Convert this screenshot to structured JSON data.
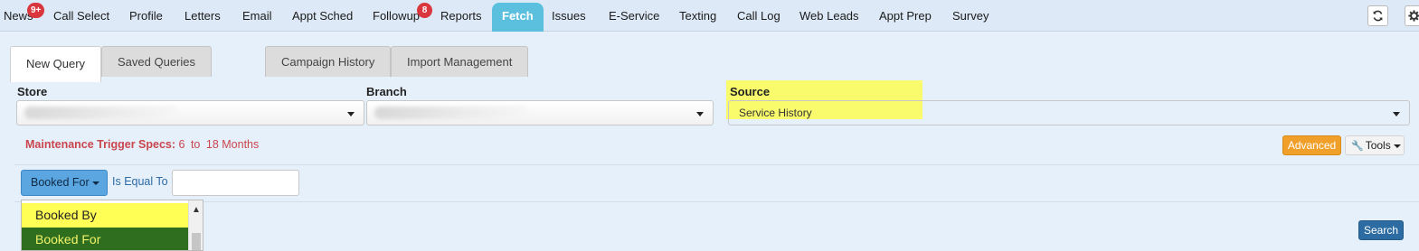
{
  "nav": {
    "items": [
      {
        "label": "News",
        "badge": "9+"
      },
      {
        "label": "Call Select"
      },
      {
        "label": "Profile"
      },
      {
        "label": "Letters"
      },
      {
        "label": "Email"
      },
      {
        "label": "Appt Sched"
      },
      {
        "label": "Followup",
        "badge": "8"
      },
      {
        "label": "Reports"
      },
      {
        "label": "Fetch",
        "active": true
      },
      {
        "label": "Issues"
      },
      {
        "label": "E-Service"
      },
      {
        "label": "Texting"
      },
      {
        "label": "Call Log"
      },
      {
        "label": "Web Leads"
      },
      {
        "label": "Appt Prep"
      },
      {
        "label": "Survey"
      }
    ],
    "refresh_icon": "refresh-icon",
    "settings_icon": "gear-icon"
  },
  "tabs": [
    {
      "label": "New Query",
      "active": true
    },
    {
      "label": "Saved Queries"
    },
    {
      "label": "Campaign History"
    },
    {
      "label": "Import Management"
    }
  ],
  "filters": {
    "store": {
      "label": "Store",
      "value": ""
    },
    "branch": {
      "label": "Branch",
      "value": ""
    },
    "source": {
      "label": "Source",
      "value": "Service History"
    }
  },
  "specs": {
    "label": "Maintenance Trigger Specs:",
    "from": "6",
    "to_word": "to",
    "to": "18 Months"
  },
  "actions": {
    "advanced": "Advanced",
    "tools": "Tools",
    "search": "Search"
  },
  "criteria": {
    "field": "Booked For",
    "operator": "Is Equal To",
    "value": ""
  },
  "dropdown": {
    "options": [
      "Booked By",
      "Booked For"
    ],
    "selected": "Booked For"
  },
  "colors": {
    "active_tab": "#5bc0de",
    "badge": "#d9363e",
    "highlight": "#ffff55",
    "advanced": "#f0a02a",
    "search": "#2d6ca2"
  }
}
